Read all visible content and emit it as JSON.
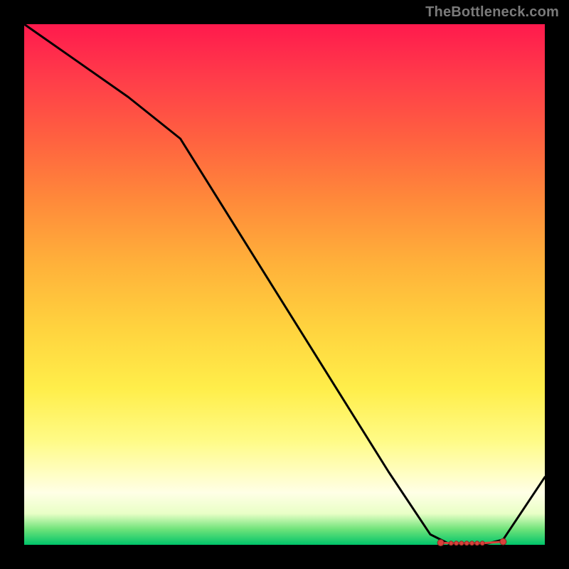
{
  "attribution": "TheBottleneck.com",
  "chart_data": {
    "type": "line",
    "x": [
      0.0,
      0.1,
      0.2,
      0.3,
      0.4,
      0.5,
      0.6,
      0.7,
      0.78,
      0.82,
      0.85,
      0.88,
      0.92,
      1.0
    ],
    "values": [
      1.0,
      0.93,
      0.86,
      0.78,
      0.62,
      0.46,
      0.3,
      0.14,
      0.02,
      0.0,
      0.0,
      0.0,
      0.01,
      0.13
    ],
    "title": "",
    "xlabel": "",
    "ylabel": "",
    "xlim": [
      0,
      1
    ],
    "ylim": [
      0,
      1
    ],
    "marker_cluster": {
      "x": [
        0.8,
        0.82,
        0.83,
        0.84,
        0.85,
        0.86,
        0.87,
        0.88,
        0.92
      ],
      "y": [
        0.004,
        0.003,
        0.003,
        0.003,
        0.003,
        0.003,
        0.003,
        0.003,
        0.006
      ]
    }
  },
  "colors": {
    "line": "#000000",
    "marker_fill": "#d9413b",
    "marker_stroke": "#8a2a25"
  }
}
